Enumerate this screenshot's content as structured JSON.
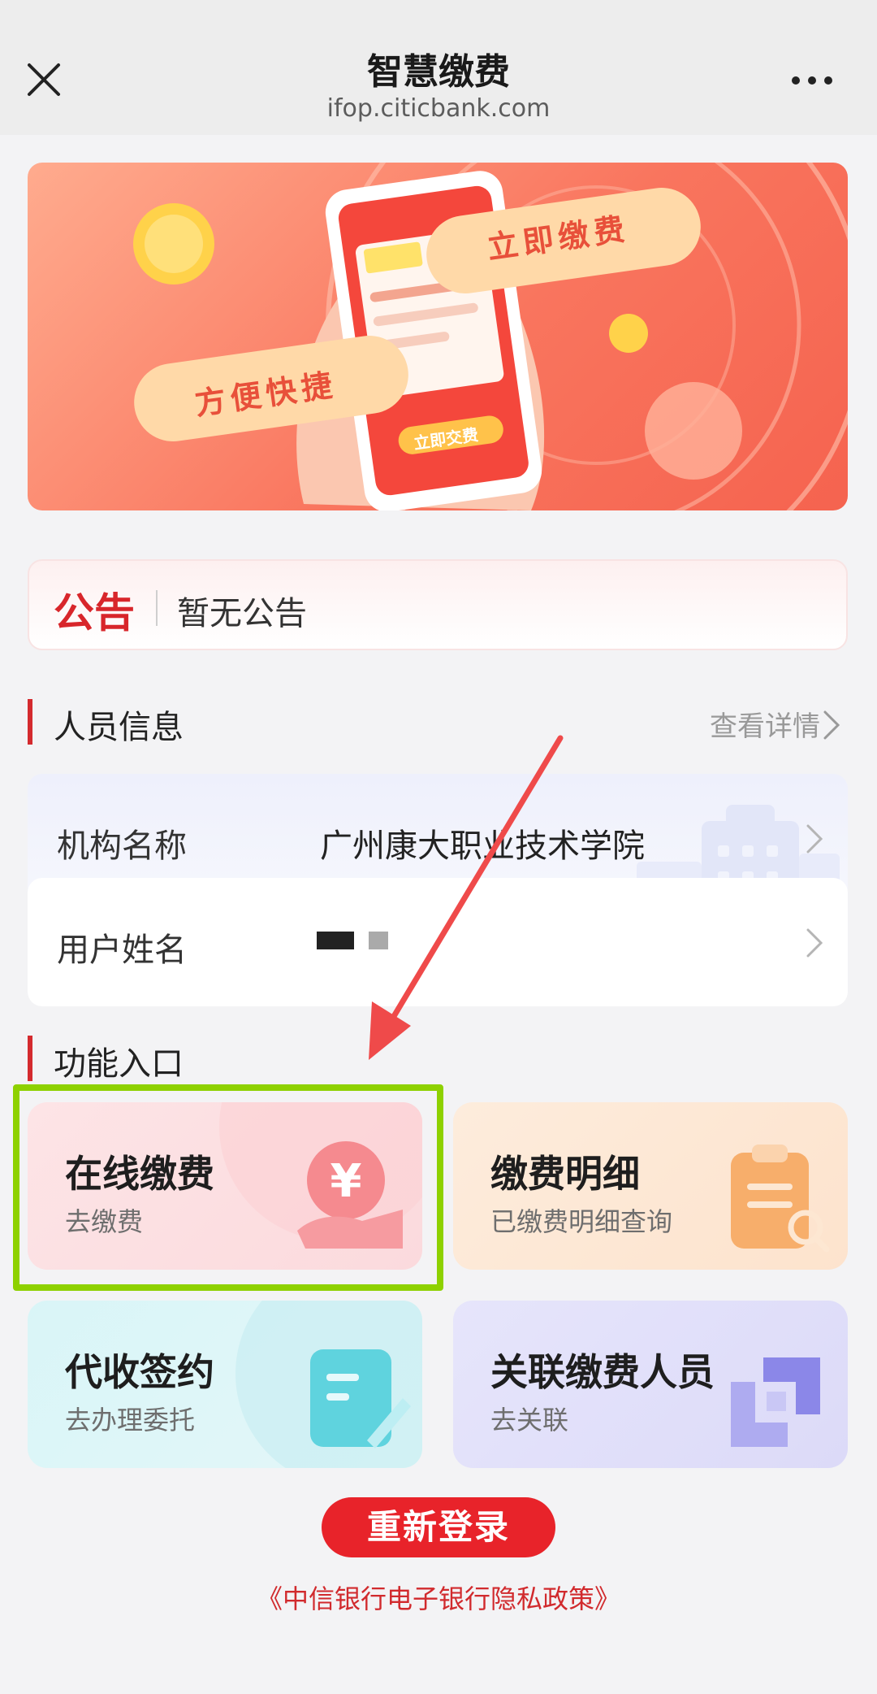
{
  "header": {
    "title": "智慧缴费",
    "subtitle": "ifop.citicbank.com"
  },
  "banner": {
    "pill_primary": "立即缴费",
    "pill_secondary": "方便快捷",
    "phone_button": "立即交费"
  },
  "notice": {
    "tag": "公告",
    "text": "暂无公告"
  },
  "personal": {
    "section_title": "人员信息",
    "details_link": "查看详情",
    "org_label": "机构名称",
    "org_value": "广州康大职业技术学院",
    "user_label": "用户姓名"
  },
  "functions": {
    "section_title": "功能入口",
    "tiles": [
      {
        "title": "在线缴费",
        "subtitle": "去缴费"
      },
      {
        "title": "缴费明细",
        "subtitle": "已缴费明细查询"
      },
      {
        "title": "代收签约",
        "subtitle": "去办理委托"
      },
      {
        "title": "关联缴费人员",
        "subtitle": "去关联"
      }
    ]
  },
  "relogin_label": "重新登录",
  "privacy_link": "《中信银行电子银行隐私政策》",
  "colors": {
    "brand_red": "#d42a2e",
    "highlight_green": "#8ed100",
    "annotation_arrow": "#ef4a4a"
  }
}
